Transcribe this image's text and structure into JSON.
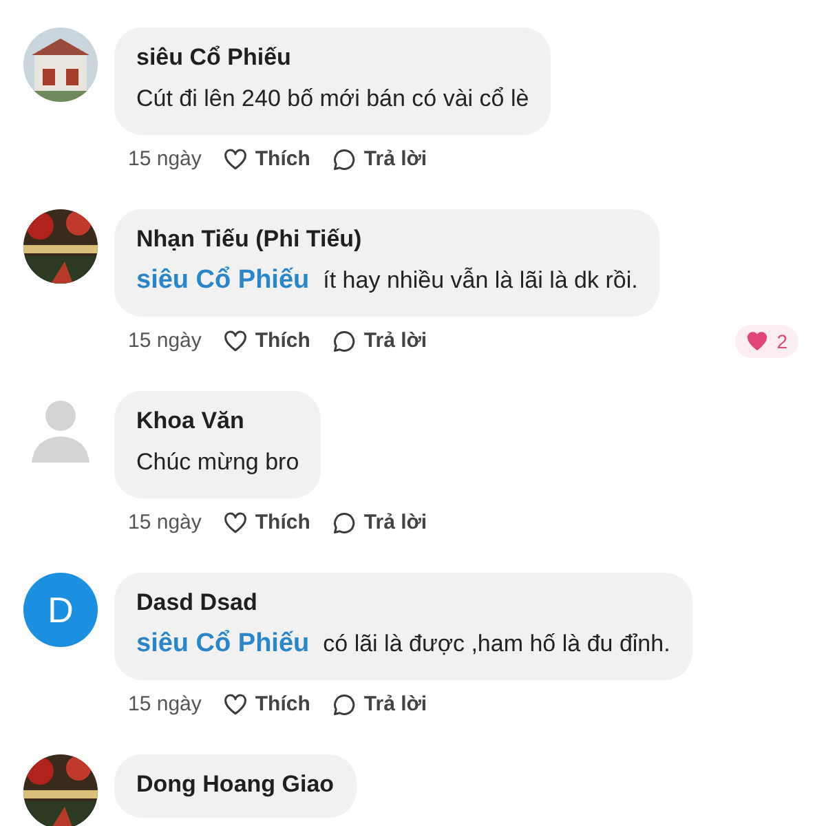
{
  "comments": [
    {
      "name": "siêu Cổ Phiếu",
      "text": "Cút đi lên 240 bố mới bán có vài cổ lè",
      "time": "15 ngày",
      "like": "Thích",
      "reply": "Trả lời"
    },
    {
      "name": "Nhạn Tiếu (Phi Tiếu)",
      "mention": "siêu Cổ Phiếu",
      "text": "ít hay nhiều vẫn là lãi là dk rồi.",
      "time": "15 ngày",
      "like": "Thích",
      "reply": "Trả lời",
      "reactions": "2"
    },
    {
      "avatar": {
        "kind": "default"
      },
      "name": "Khoa Văn",
      "text": "Chúc mừng bro",
      "time": "15 ngày",
      "like": "Thích",
      "reply": "Trả lời"
    },
    {
      "avatar": {
        "kind": "letter",
        "letter": "D",
        "color": "#1d8fe0"
      },
      "name": "Dasd Dsad",
      "mention": "siêu Cổ Phiếu",
      "text": "có lãi là được ,ham hố là đu đỉnh.",
      "time": "15 ngày",
      "like": "Thích",
      "reply": "Trả lời"
    },
    {
      "name": "Dong Hoang Giao"
    }
  ]
}
